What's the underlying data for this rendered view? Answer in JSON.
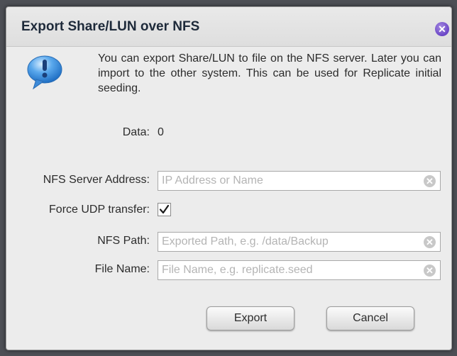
{
  "dialog": {
    "title": "Export Share/LUN over NFS",
    "close_icon": "close-icon",
    "info_icon": "info-exclamation-icon",
    "message": "You can export Share/LUN to file on the NFS server. Later you can import to the other system. This can be used for Replicate initial seeding."
  },
  "data_row": {
    "label": "Data:",
    "value": "0"
  },
  "fields": {
    "nfs_server": {
      "label": "NFS Server Address:",
      "value": "",
      "placeholder": "IP Address or Name"
    },
    "force_udp": {
      "label": "Force UDP transfer:",
      "checked": true
    },
    "nfs_path": {
      "label": "NFS Path:",
      "value": "",
      "placeholder": "Exported Path, e.g. /data/Backup"
    },
    "file_name": {
      "label": "File Name:",
      "value": "",
      "placeholder": "File Name, e.g. replicate.seed"
    }
  },
  "buttons": {
    "export_label": "Export",
    "cancel_label": "Cancel"
  },
  "colors": {
    "close_button": "#6a45c7",
    "info_icon": "#2f86d6",
    "dialog_background": "#ececec"
  }
}
